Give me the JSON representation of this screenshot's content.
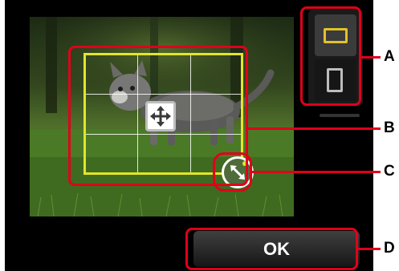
{
  "screen": {
    "ok_button_label": "OK"
  },
  "orientation": {
    "options": [
      "landscape",
      "portrait"
    ],
    "selected": "landscape"
  },
  "photo": {
    "subject": "kitten on grass"
  },
  "callouts": {
    "a": "A",
    "b": "B",
    "c": "C",
    "d": "D"
  },
  "colors": {
    "callout": "#e0001b",
    "trim_frame": "#e3e52a",
    "selected_orientation": "#e3c22c"
  },
  "icons": {
    "move": "move-arrows-icon",
    "resize": "resize-arrow-icon"
  }
}
